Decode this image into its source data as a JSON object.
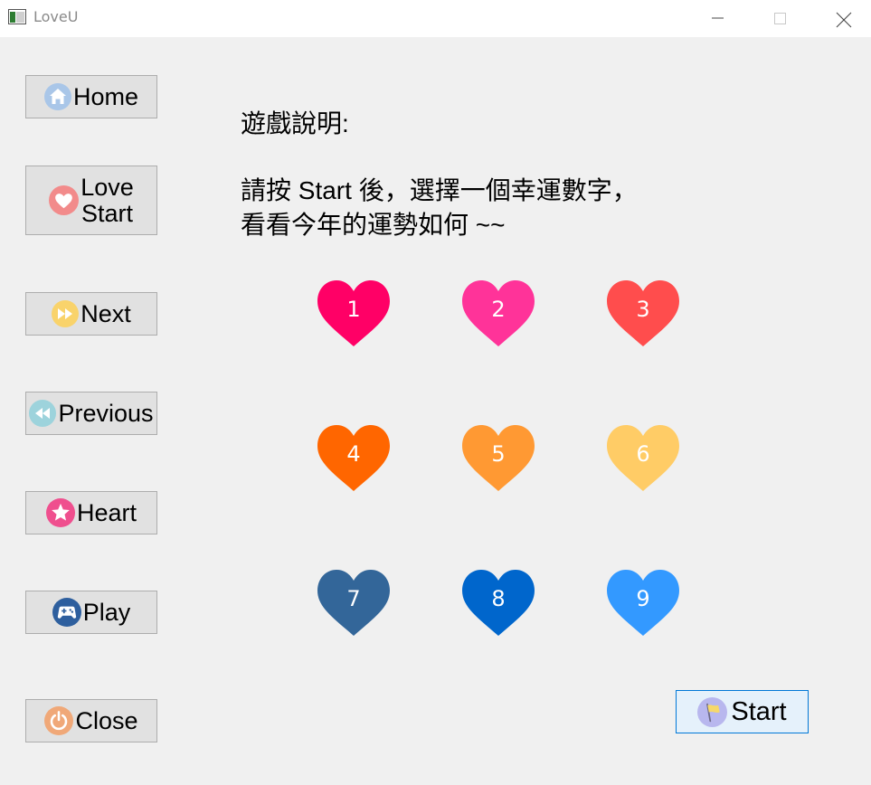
{
  "window": {
    "title": "LoveU"
  },
  "sidebar": {
    "home": "Home",
    "love_start_line1": "Love",
    "love_start_line2": "Start",
    "next": "Next",
    "previous": "Previous",
    "heart": "Heart",
    "play": "Play",
    "close": "Close"
  },
  "instructions": {
    "heading": "遊戲說明:",
    "line1": "請按 Start 後，選擇一個幸運數字，",
    "line2": "看看今年的運勢如何 ~~"
  },
  "hearts": [
    {
      "number": "1",
      "color": "#ff0066"
    },
    {
      "number": "2",
      "color": "#ff3399"
    },
    {
      "number": "3",
      "color": "#ff4d4d"
    },
    {
      "number": "4",
      "color": "#ff6600"
    },
    {
      "number": "5",
      "color": "#ff9933"
    },
    {
      "number": "6",
      "color": "#ffcc66"
    },
    {
      "number": "7",
      "color": "#336699"
    },
    {
      "number": "8",
      "color": "#0066cc"
    },
    {
      "number": "9",
      "color": "#3399ff"
    }
  ],
  "start_button": {
    "label": "Start"
  },
  "icons": {
    "home": "home-icon",
    "love_start": "heart-icon",
    "next": "fast-forward-icon",
    "previous": "rewind-icon",
    "heart": "star-icon",
    "play": "gamepad-icon",
    "close": "power-icon",
    "start": "flag-icon"
  }
}
